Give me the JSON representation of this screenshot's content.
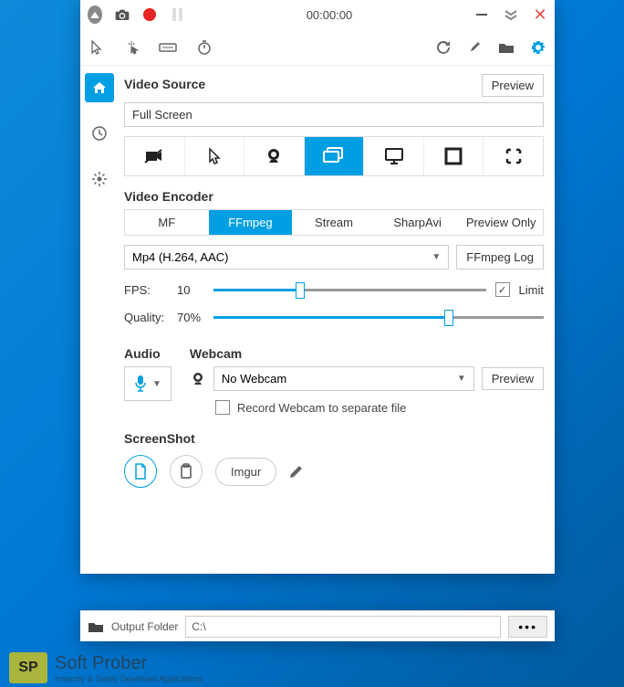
{
  "titlebar": {
    "timer": "00:00:00"
  },
  "sections": {
    "videoSource": {
      "title": "Video Source",
      "previewBtn": "Preview",
      "value": "Full Screen"
    },
    "videoEncoder": {
      "title": "Video Encoder",
      "tabs": [
        "MF",
        "FFmpeg",
        "Stream",
        "SharpAvi",
        "Preview Only"
      ],
      "activeTab": 1,
      "format": "Mp4 (H.264, AAC)",
      "logBtn": "FFmpeg Log",
      "fps": {
        "label": "FPS:",
        "value": "10",
        "limitLabel": "Limit",
        "limitChecked": true,
        "percent": 30
      },
      "quality": {
        "label": "Quality:",
        "value": "70%",
        "percent": 70
      }
    },
    "audio": {
      "title": "Audio"
    },
    "webcam": {
      "title": "Webcam",
      "value": "No Webcam",
      "previewBtn": "Preview",
      "separateLabel": "Record Webcam to separate file"
    },
    "screenshot": {
      "title": "ScreenShot",
      "imgurBtn": "Imgur"
    }
  },
  "bottomBar": {
    "label": "Output Folder",
    "path": "C:\\"
  },
  "watermark": {
    "badge": "SP",
    "name": "Soft Prober",
    "tagline": "Instantly & Safely Download Applications"
  }
}
